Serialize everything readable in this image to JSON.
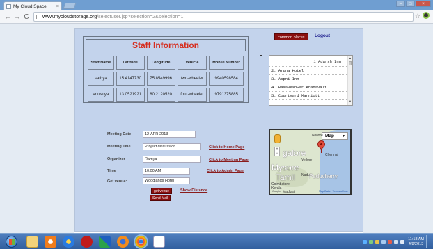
{
  "browser": {
    "tab_title": "My Cloud Space",
    "tab_close": "×",
    "url_host": "www.mycloudstorage.org",
    "url_path": "/selectuser.jsp?selection=2&selection=1",
    "back": "←",
    "forward": "→",
    "reload": "C",
    "bookmark_star": "☆"
  },
  "header": {
    "places_button": "common places",
    "logout": "Logout"
  },
  "staff": {
    "title": "Staff Information",
    "columns": [
      "Staff Name",
      "Latitude",
      "Longitude",
      "Vehicle",
      "Mobile Number"
    ],
    "rows": [
      [
        "sathya",
        "15.4147730",
        "75.8549996",
        "two-wheeler",
        "9940598584"
      ],
      [
        "anusuya",
        "13.0521921",
        "80.2120520",
        "four-wheeler",
        "9791375885"
      ]
    ]
  },
  "places": {
    "items": [
      "1.Adarsh Inn",
      "2. Aruna Hotel",
      "3. Aspni Inn",
      "4. Basaveshwar Khanavali",
      "5. Courtyard Marriott"
    ],
    "scroll_up": "▲",
    "scroll_down": "▼"
  },
  "meeting": {
    "date_label": "Meeting Date",
    "date_value": "12-APR-2013",
    "title_label": "Meeting Title",
    "title_value": "Project discussion",
    "organizer_label": "Organizer",
    "organizer_value": "Ramya",
    "time_label": "Time",
    "time_value": "10.00 AM",
    "venue_label": "Get venue:",
    "venue_value": "Woodlands Hotel",
    "get_venue_button": "get venue",
    "show_distance": "Show Distance",
    "send_mail_button": "Send Mail"
  },
  "links": {
    "home": "Click to Home Page",
    "meeting": "Click to Meeting Page",
    "admin": "Click to Admin Page"
  },
  "map": {
    "type_select": "Map",
    "caret": "▼",
    "zoom_in": "+",
    "zoom_out": "−",
    "labels": {
      "nellore": "Nellore",
      "bangalore": "galore",
      "chennai": "Chennai",
      "vellore": "Vellore",
      "mysore": "Mysore",
      "tamil": "Tamil",
      "nadu": "Nadu",
      "puducherry": "Puducherry",
      "coimbatore": "Coimbatore",
      "madurai": "Madurai",
      "kerala": "Kerala"
    },
    "footer_logo": "Google",
    "footer_links": "Map Data · Terms of Use"
  },
  "taskbar": {
    "clock_time": "11:18 AM",
    "clock_date": "4/8/2013"
  },
  "colors": {
    "accent_red": "#8a1010",
    "title_red": "#d62b1c",
    "panel_blue": "#c3d3ec"
  }
}
